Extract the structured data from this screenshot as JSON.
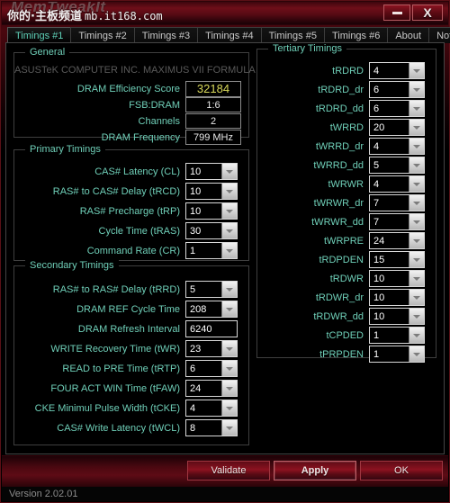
{
  "window": {
    "ghost_title": "MemTweakIt",
    "watermark_cn": "你的·主板频道",
    "watermark_url": "mb.it168.com",
    "minimize_label": "Minimize",
    "close_label": "X"
  },
  "tabs": [
    {
      "label": "Timings #1",
      "active": true
    },
    {
      "label": "Timings #2",
      "active": false
    },
    {
      "label": "Timings #3",
      "active": false
    },
    {
      "label": "Timings #4",
      "active": false
    },
    {
      "label": "Timings #5",
      "active": false
    },
    {
      "label": "Timings #6",
      "active": false
    },
    {
      "label": "About",
      "active": false
    },
    {
      "label": "Notice",
      "active": false
    }
  ],
  "general": {
    "legend": "General",
    "board_name": "ASUSTeK COMPUTER INC. MAXIMUS VII FORMULA",
    "rows": [
      {
        "label": "DRAM Efficiency Score",
        "value": "32184",
        "kind": "score"
      },
      {
        "label": "FSB:DRAM",
        "value": "1:6",
        "kind": "readonly"
      },
      {
        "label": "Channels",
        "value": "2",
        "kind": "readonly"
      },
      {
        "label": "DRAM Frequency",
        "value": "799 MHz",
        "kind": "readonly"
      }
    ]
  },
  "primary": {
    "legend": "Primary Timings",
    "rows": [
      {
        "label": "CAS# Latency (CL)",
        "value": "10",
        "kind": "combo"
      },
      {
        "label": "RAS# to CAS# Delay (tRCD)",
        "value": "10",
        "kind": "combo"
      },
      {
        "label": "RAS# Precharge (tRP)",
        "value": "10",
        "kind": "combo"
      },
      {
        "label": "Cycle Time (tRAS)",
        "value": "30",
        "kind": "combo"
      },
      {
        "label": "Command Rate (CR)",
        "value": "1",
        "kind": "combo"
      }
    ]
  },
  "secondary": {
    "legend": "Secondary Timings",
    "rows": [
      {
        "label": "RAS# to RAS# Delay (tRRD)",
        "value": "5",
        "kind": "combo"
      },
      {
        "label": "DRAM REF Cycle Time",
        "value": "208",
        "kind": "combo"
      },
      {
        "label": "DRAM Refresh Interval",
        "value": "6240",
        "kind": "text"
      },
      {
        "label": "WRITE Recovery Time (tWR)",
        "value": "23",
        "kind": "combo"
      },
      {
        "label": "READ to PRE Time (tRTP)",
        "value": "6",
        "kind": "combo"
      },
      {
        "label": "FOUR ACT WIN Time (tFAW)",
        "value": "24",
        "kind": "combo"
      },
      {
        "label": "CKE Minimul Pulse Width (tCKE)",
        "value": "4",
        "kind": "combo"
      },
      {
        "label": "CAS# Write Latency (tWCL)",
        "value": "8",
        "kind": "combo"
      }
    ]
  },
  "tertiary": {
    "legend": "Tertiary Timings",
    "rows": [
      {
        "label": "tRDRD",
        "value": "4",
        "kind": "combo"
      },
      {
        "label": "tRDRD_dr",
        "value": "6",
        "kind": "combo"
      },
      {
        "label": "tRDRD_dd",
        "value": "6",
        "kind": "combo"
      },
      {
        "label": "tWRRD",
        "value": "20",
        "kind": "combo"
      },
      {
        "label": "tWRRD_dr",
        "value": "4",
        "kind": "combo"
      },
      {
        "label": "tWRRD_dd",
        "value": "5",
        "kind": "combo"
      },
      {
        "label": "tWRWR",
        "value": "4",
        "kind": "combo"
      },
      {
        "label": "tWRWR_dr",
        "value": "7",
        "kind": "combo"
      },
      {
        "label": "tWRWR_dd",
        "value": "7",
        "kind": "combo"
      },
      {
        "label": "tWRPRE",
        "value": "24",
        "kind": "combo"
      },
      {
        "label": "tRDPDEN",
        "value": "15",
        "kind": "combo"
      },
      {
        "label": "tRDWR",
        "value": "10",
        "kind": "combo"
      },
      {
        "label": "tRDWR_dr",
        "value": "10",
        "kind": "combo"
      },
      {
        "label": "tRDWR_dd",
        "value": "10",
        "kind": "combo"
      },
      {
        "label": "tCPDED",
        "value": "1",
        "kind": "combo"
      },
      {
        "label": "tPRPDEN",
        "value": "1",
        "kind": "combo"
      }
    ]
  },
  "buttons": [
    {
      "label": "Validate",
      "focused": false
    },
    {
      "label": "Apply",
      "focused": true
    },
    {
      "label": "OK",
      "focused": false
    }
  ],
  "status": {
    "version": "Version 2.02.01"
  },
  "colors": {
    "accent_red": "#8c1220",
    "label_teal": "#6fcfb8",
    "score_yellow": "#d8d85a",
    "field_border": "#d8d8d8"
  }
}
